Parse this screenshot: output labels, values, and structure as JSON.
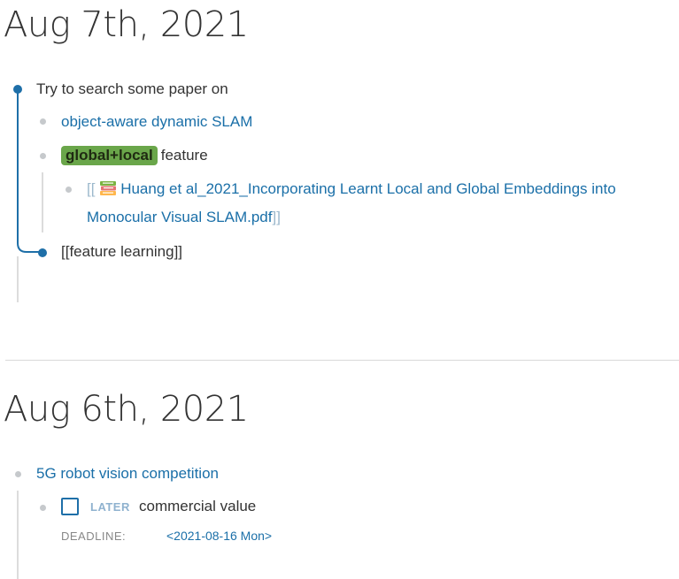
{
  "journal_1": {
    "title": "Aug 7th, 2021",
    "block_1": {
      "text": "Try to search some paper on"
    },
    "child_1": {
      "link": "object-aware dynamic SLAM"
    },
    "child_2": {
      "tag": "global+local",
      "text": "feature"
    },
    "grandchild_1": {
      "open_brackets": "[[",
      "icon": "books-icon",
      "link_line1": "Huang et al_2021_Incorporating Learnt Local and Global Embeddings into",
      "link_line2": "Monocular Visual SLAM.pdf",
      "close_brackets": "]]"
    },
    "block_2": {
      "text": "[[feature learning]]"
    }
  },
  "journal_2": {
    "title": "Aug 6th, 2021",
    "block_1": {
      "link": "5G robot vision competition"
    },
    "task": {
      "marker": "LATER",
      "text": "commercial value",
      "prop_key": "DEADLINE:",
      "prop_value": "<2021-08-16 Mon>"
    }
  },
  "colors": {
    "accent": "#1e6fa8",
    "link": "#1a6fa8",
    "tag_bg": "#6aa64a",
    "marker": "#8fb2cf"
  }
}
